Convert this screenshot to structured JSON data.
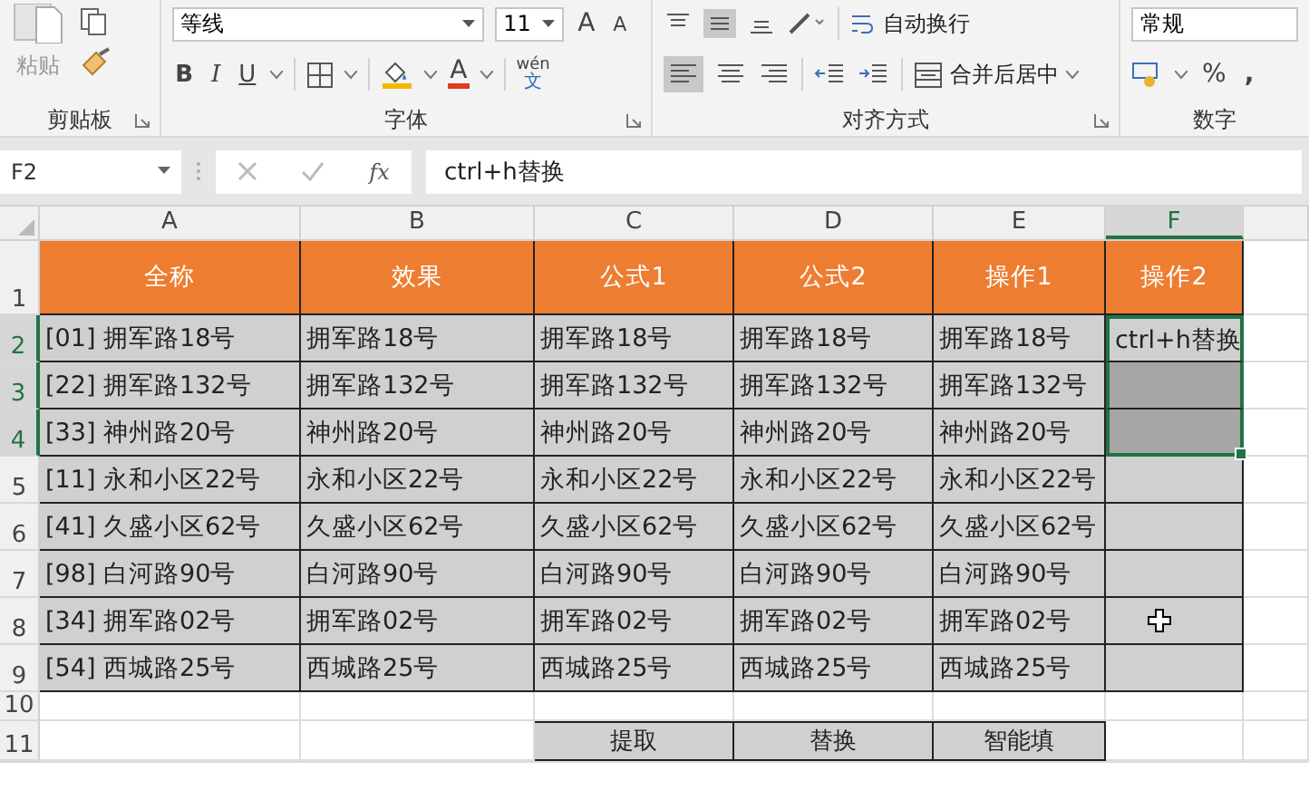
{
  "ribbon": {
    "clipboard": {
      "paste_label": "粘贴",
      "group_label": "剪贴板"
    },
    "font": {
      "family": "等线",
      "size": "11",
      "grow": "A",
      "shrink": "A",
      "bold": "B",
      "italic": "I",
      "underline": "U",
      "font_color": "A",
      "phonetic_top": "wén",
      "phonetic_bottom": "文",
      "group_label": "字体"
    },
    "alignment": {
      "wrap_text": "自动换行",
      "merge_center": "合并后居中",
      "align_left_selected": true,
      "group_label": "对齐方式"
    },
    "number": {
      "format": "常规",
      "percent": "%",
      "comma": ",",
      "group_label": "数字"
    }
  },
  "formula_bar": {
    "name_box": "F2",
    "function_label": "fx",
    "value": "ctrl+h替换"
  },
  "columns": [
    {
      "label": "A",
      "selected": false
    },
    {
      "label": "B",
      "selected": false
    },
    {
      "label": "C",
      "selected": false
    },
    {
      "label": "D",
      "selected": false
    },
    {
      "label": "E",
      "selected": false
    },
    {
      "label": "F",
      "selected": true
    }
  ],
  "rows": [
    {
      "number": "1",
      "selected": false,
      "cells": [
        {
          "kind": "header",
          "text": "全称"
        },
        {
          "kind": "header",
          "text": "效果"
        },
        {
          "kind": "header",
          "text": "公式1"
        },
        {
          "kind": "header",
          "text": "公式2"
        },
        {
          "kind": "header",
          "text": "操作1"
        },
        {
          "kind": "header",
          "text": "操作2"
        }
      ]
    },
    {
      "number": "2",
      "selected": true,
      "cells": [
        {
          "kind": "data",
          "text": "[01] 拥军路18号"
        },
        {
          "kind": "data",
          "text": "拥军路18号"
        },
        {
          "kind": "data",
          "text": "拥军路18号"
        },
        {
          "kind": "data",
          "text": "拥军路18号"
        },
        {
          "kind": "data",
          "text": "拥军路18号"
        },
        {
          "kind": "data",
          "text": "ctrl+h替换",
          "selected": true,
          "active": true
        }
      ]
    },
    {
      "number": "3",
      "selected": true,
      "cells": [
        {
          "kind": "data",
          "text": "[22] 拥军路132号"
        },
        {
          "kind": "data",
          "text": "拥军路132号"
        },
        {
          "kind": "data",
          "text": "拥军路132号"
        },
        {
          "kind": "data",
          "text": "拥军路132号"
        },
        {
          "kind": "data",
          "text": "拥军路132号"
        },
        {
          "kind": "data",
          "selected": true,
          "active": false
        }
      ]
    },
    {
      "number": "4",
      "selected": true,
      "cells": [
        {
          "kind": "data",
          "text": "[33] 神州路20号"
        },
        {
          "kind": "data",
          "text": "神州路20号"
        },
        {
          "kind": "data",
          "text": "神州路20号"
        },
        {
          "kind": "data",
          "text": "神州路20号"
        },
        {
          "kind": "data",
          "text": "神州路20号"
        },
        {
          "kind": "data",
          "selected": true,
          "active": false
        }
      ]
    },
    {
      "number": "5",
      "selected": false,
      "cells": [
        {
          "kind": "data",
          "text": "[11] 永和小区22号"
        },
        {
          "kind": "data",
          "text": "永和小区22号"
        },
        {
          "kind": "data",
          "text": "永和小区22号"
        },
        {
          "kind": "data",
          "text": "永和小区22号"
        },
        {
          "kind": "data",
          "text": "永和小区22号"
        },
        {
          "kind": "data"
        }
      ]
    },
    {
      "number": "6",
      "selected": false,
      "cells": [
        {
          "kind": "data",
          "text": "[41] 久盛小区62号"
        },
        {
          "kind": "data",
          "text": "久盛小区62号"
        },
        {
          "kind": "data",
          "text": "久盛小区62号"
        },
        {
          "kind": "data",
          "text": "久盛小区62号"
        },
        {
          "kind": "data",
          "text": "久盛小区62号"
        },
        {
          "kind": "data"
        }
      ]
    },
    {
      "number": "7",
      "selected": false,
      "cells": [
        {
          "kind": "data",
          "text": "[98] 白河路90号"
        },
        {
          "kind": "data",
          "text": "白河路90号"
        },
        {
          "kind": "data",
          "text": "白河路90号"
        },
        {
          "kind": "data",
          "text": "白河路90号"
        },
        {
          "kind": "data",
          "text": "白河路90号"
        },
        {
          "kind": "data"
        }
      ]
    },
    {
      "number": "8",
      "selected": false,
      "cells": [
        {
          "kind": "data",
          "text": "[34] 拥军路02号"
        },
        {
          "kind": "data",
          "text": "拥军路02号"
        },
        {
          "kind": "data",
          "text": "拥军路02号"
        },
        {
          "kind": "data",
          "text": "拥军路02号"
        },
        {
          "kind": "data",
          "text": "拥军路02号"
        },
        {
          "kind": "data",
          "cursor": true
        }
      ]
    },
    {
      "number": "9",
      "selected": false,
      "cells": [
        {
          "kind": "data",
          "text": "[54] 西城路25号"
        },
        {
          "kind": "data",
          "text": "西城路25号"
        },
        {
          "kind": "data",
          "text": "西城路25号"
        },
        {
          "kind": "data",
          "text": "西城路25号"
        },
        {
          "kind": "data",
          "text": "西城路25号"
        },
        {
          "kind": "data"
        }
      ]
    },
    {
      "number": "10",
      "selected": false,
      "cells": [
        {
          "kind": "blank"
        },
        {
          "kind": "blank"
        },
        {
          "kind": "blank"
        },
        {
          "kind": "blank"
        },
        {
          "kind": "blank"
        },
        {
          "kind": "blank"
        }
      ]
    },
    {
      "number": "11",
      "selected": false,
      "cells": [
        {
          "kind": "blank"
        },
        {
          "kind": "blank"
        },
        {
          "kind": "label",
          "text": "提取"
        },
        {
          "kind": "label",
          "text": "替换"
        },
        {
          "kind": "label",
          "text": "智能填"
        },
        {
          "kind": "blank"
        }
      ]
    }
  ]
}
